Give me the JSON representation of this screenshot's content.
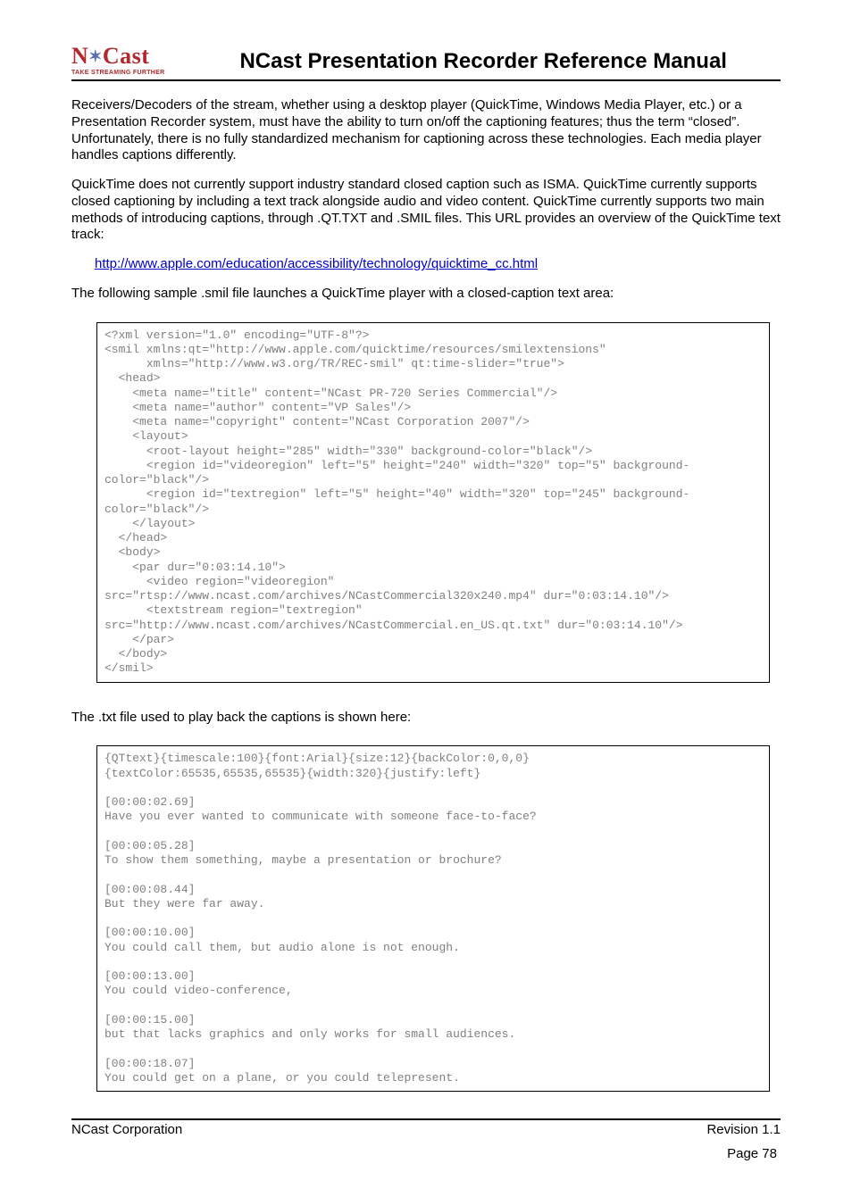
{
  "logo": {
    "brand": "N Cast",
    "tagline": "TAKE STREAMING FURTHER"
  },
  "title": "NCast Presentation Recorder Reference Manual",
  "body": {
    "p1": "Receivers/Decoders of the stream, whether using a desktop player (QuickTime, Windows Media Player, etc.) or a Presentation Recorder system, must have the ability to turn on/off the captioning features;  thus the term “closed”.  Unfortunately, there is no fully standardized mechanism for captioning across these technologies.  Each media player handles captions differently.",
    "p2": "QuickTime does not currently support industry standard closed caption such as ISMA.  QuickTime currently supports closed captioning by including a text track alongside audio and video content. QuickTime currently supports two main methods of introducing captions, through .QT.TXT and .SMIL files.  This URL provides an overview of the QuickTime text track:",
    "link": "http://www.apple.com/education/accessibility/technology/quicktime_cc.html",
    "p3": "The following sample .smil file launches a QuickTime player with a closed-caption text area:",
    "code1": "<?xml version=\"1.0\" encoding=\"UTF-8\"?>\n<smil xmlns:qt=\"http://www.apple.com/quicktime/resources/smilextensions\"\n      xmlns=\"http://www.w3.org/TR/REC-smil\" qt:time-slider=\"true\">\n  <head>\n    <meta name=\"title\" content=\"NCast PR-720 Series Commercial\"/>\n    <meta name=\"author\" content=\"VP Sales\"/>\n    <meta name=\"copyright\" content=\"NCast Corporation 2007\"/>\n    <layout>\n      <root-layout height=\"285\" width=\"330\" background-color=\"black\"/>\n      <region id=\"videoregion\" left=\"5\" height=\"240\" width=\"320\" top=\"5\" background-color=\"black\"/>\n      <region id=\"textregion\" left=\"5\" height=\"40\" width=\"320\" top=\"245\" background-color=\"black\"/>\n    </layout>\n  </head>\n  <body>\n    <par dur=\"0:03:14.10\">\n      <video region=\"videoregion\" src=\"rtsp://www.ncast.com/archives/NCastCommercial320x240.mp4\" dur=\"0:03:14.10\"/>\n      <textstream region=\"textregion\" src=\"http://www.ncast.com/archives/NCastCommercial.en_US.qt.txt\" dur=\"0:03:14.10\"/>\n    </par>\n  </body>\n</smil>",
    "p4": "The .txt file used to play back the captions is shown here:",
    "code2": "{QTtext}{timescale:100}{font:Arial}{size:12}{backColor:0,0,0}\n{textColor:65535,65535,65535}{width:320}{justify:left}\n\n[00:00:02.69]\nHave you ever wanted to communicate with someone face-to-face?\n\n[00:00:05.28]\nTo show them something, maybe a presentation or brochure?\n\n[00:00:08.44]\nBut they were far away.\n\n[00:00:10.00]\nYou could call them, but audio alone is not enough.\n\n[00:00:13.00]\nYou could video-conference,\n\n[00:00:15.00]\nbut that lacks graphics and only works for small audiences.\n\n[00:00:18.07]\nYou could get on a plane, or you could telepresent."
  },
  "footer": {
    "left": "NCast Corporation",
    "right": "Revision 1.1",
    "page": "Page 78"
  }
}
